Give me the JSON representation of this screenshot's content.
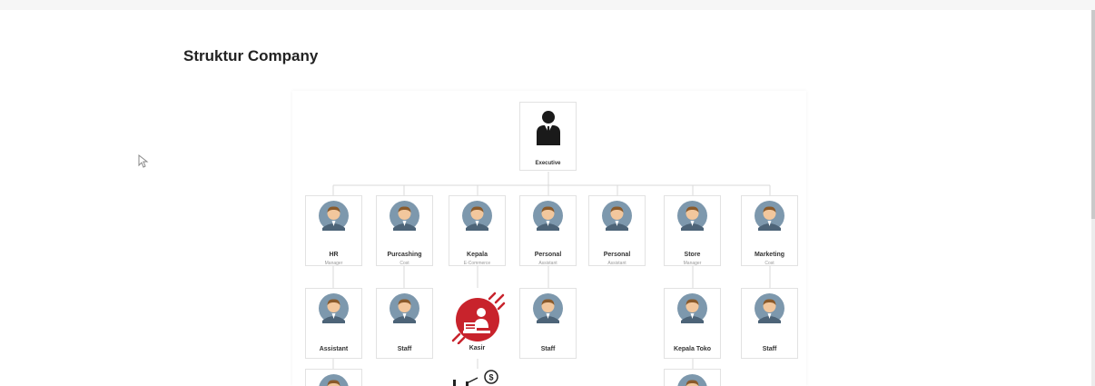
{
  "page": {
    "title": "Struktur Company"
  },
  "colors": {
    "accent_red": "#c8232c",
    "avatar_bg": "#7d98ad",
    "skin": "#f2c79d",
    "hair": "#8a5a2b",
    "line": "#d9d9d9"
  },
  "org": {
    "top": {
      "name": "Executive",
      "icon": "businessman-icon"
    },
    "level1": [
      {
        "name": "HR",
        "role": "Manager",
        "icon": "employee-avatar-icon"
      },
      {
        "name": "Purcashing",
        "role": "Cost",
        "icon": "employee-avatar-icon"
      },
      {
        "name": "Kepala",
        "role": "E-Commerce",
        "icon": "employee-avatar-icon"
      },
      {
        "name": "Personal",
        "role": "Assistant",
        "icon": "employee-avatar-icon"
      },
      {
        "name": "Personal",
        "role": "Assistant",
        "icon": "employee-avatar-icon"
      },
      {
        "name": "Store",
        "role": "Manager",
        "icon": "employee-avatar-icon"
      },
      {
        "name": "Marketing",
        "role": "Cost",
        "icon": "employee-avatar-icon"
      }
    ],
    "level2": [
      {
        "name": "Assistant",
        "icon": "employee-avatar-icon"
      },
      {
        "name": "Staff",
        "icon": "employee-avatar-icon"
      },
      {
        "name": "Kasir",
        "icon": "cashier-icon"
      },
      {
        "name": "Staff",
        "icon": "employee-avatar-icon"
      },
      {
        "name": "Kepala Toko",
        "icon": "employee-avatar-icon"
      },
      {
        "name": "Staff",
        "icon": "employee-avatar-icon"
      }
    ],
    "level3_icons": [
      "employee-avatar-icon",
      "money-chart-icon",
      "employee-avatar-icon"
    ]
  }
}
